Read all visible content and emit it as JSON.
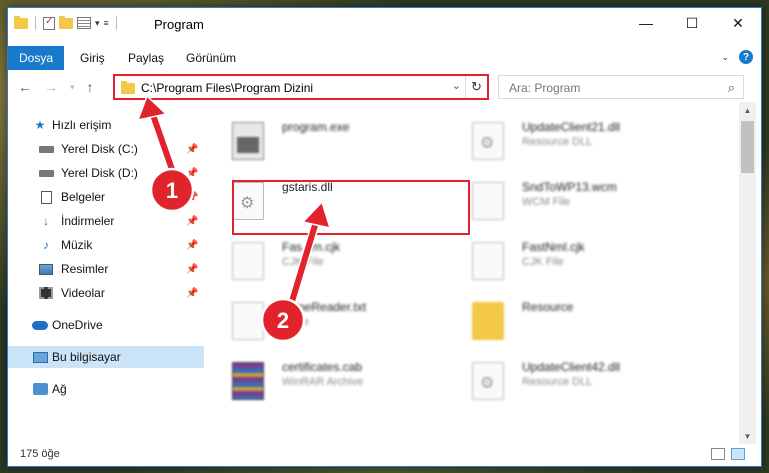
{
  "window": {
    "title": "Program",
    "controls": [
      "minimize",
      "maximize",
      "close"
    ]
  },
  "ribbon": {
    "file_tab": "Dosya",
    "tabs": [
      "Giriş",
      "Paylaş",
      "Görünüm"
    ]
  },
  "nav": {
    "address": "C:\\Program Files\\Program Dizini",
    "search_placeholder": "Ara: Program"
  },
  "sidebar": {
    "items": [
      {
        "label": "Hızlı erişim",
        "icon": "star-icon"
      },
      {
        "label": "Yerel Disk (C:)",
        "icon": "disk-icon",
        "pinned": true
      },
      {
        "label": "Yerel Disk (D:)",
        "icon": "disk-icon",
        "pinned": true
      },
      {
        "label": "Belgeler",
        "icon": "document-icon",
        "pinned": true
      },
      {
        "label": "İndirmeler",
        "icon": "download-icon",
        "pinned": true
      },
      {
        "label": "Müzik",
        "icon": "music-icon",
        "pinned": true
      },
      {
        "label": "Resimler",
        "icon": "pictures-icon",
        "pinned": true
      },
      {
        "label": "Videolar",
        "icon": "videos-icon",
        "pinned": true
      },
      {
        "label": "OneDrive",
        "icon": "cloud-icon"
      },
      {
        "label": "Bu bilgisayar",
        "icon": "computer-icon",
        "selected": true
      },
      {
        "label": "Ağ",
        "icon": "network-icon"
      }
    ]
  },
  "files": [
    {
      "name": "program.exe",
      "type": "",
      "icon": "exe-icon"
    },
    {
      "name": "UpdateClient21.dll",
      "type": "Resource DLL",
      "icon": "dll-icon"
    },
    {
      "name": "gstaris.dll",
      "type": "",
      "icon": "dll-icon",
      "highlighted": true
    },
    {
      "name": "SndToWP13.wcm",
      "type": "WCM File",
      "icon": "blank-file-icon"
    },
    {
      "name": "Fas...m.cjk",
      "type": "CJK File",
      "icon": "blank-file-icon"
    },
    {
      "name": "FastNml.cjk",
      "type": "CJK File",
      "icon": "blank-file-icon"
    },
    {
      "name": "...fineReader.txt",
      "type": "...File",
      "icon": "blank-file-icon"
    },
    {
      "name": "Resource",
      "type": "",
      "icon": "folder-icon"
    },
    {
      "name": "certificates.cab",
      "type": "WinRAR Archive",
      "icon": "archive-icon"
    },
    {
      "name": "UpdateClient42.dll",
      "type": "Resource DLL",
      "icon": "dll-icon"
    }
  ],
  "status": {
    "item_count": "175 öğe"
  },
  "annotations": {
    "step1": "1",
    "step2": "2",
    "color": "#e1242c"
  }
}
